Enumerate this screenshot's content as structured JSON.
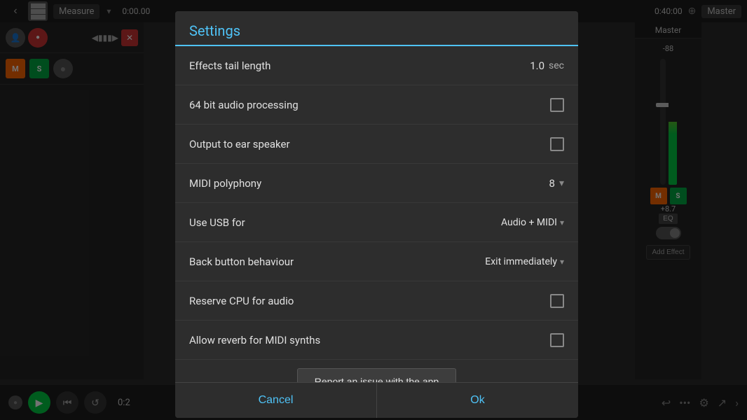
{
  "topbar": {
    "nav_back": "‹",
    "grid_icon": "grid",
    "measure_label": "Measure",
    "dropdown": "▾",
    "time_left": "0:00.00",
    "time_right": "0:40:00",
    "master_label": "Master",
    "knob_icon": "⊕"
  },
  "transport": {
    "record_label": "●",
    "play_label": "▶",
    "rewind_label": "⏮",
    "loop_label": "↺",
    "time_code": "0:2",
    "share_icon": "↗",
    "dots_icon": "•••",
    "gear_icon": "⚙",
    "arrow_icon": "›"
  },
  "master_panel": {
    "title": "Master",
    "volume_slider": "-88",
    "db_value": "+8.7",
    "m_label": "M",
    "s_label": "S",
    "eq_label": "EQ",
    "add_effect": "Add Effect"
  },
  "settings": {
    "title": "Settings",
    "items": [
      {
        "label": "Effects tail length",
        "value": "1.0",
        "unit": "sec",
        "type": "number"
      },
      {
        "label": "64 bit audio processing",
        "value": "",
        "type": "checkbox",
        "checked": false
      },
      {
        "label": "Output to ear speaker",
        "value": "",
        "type": "checkbox",
        "checked": false
      },
      {
        "label": "MIDI polyphony",
        "value": "8",
        "type": "spinner"
      },
      {
        "label": "Use USB for",
        "value": "Audio + MIDI",
        "type": "dropdown"
      },
      {
        "label": "Back button behaviour",
        "value": "Exit immediately",
        "type": "dropdown"
      },
      {
        "label": "Reserve CPU for audio",
        "value": "",
        "type": "checkbox",
        "checked": false
      },
      {
        "label": "Allow reverb for MIDI synths",
        "value": "",
        "type": "checkbox",
        "checked": false
      }
    ],
    "report_btn": "Report an issue with the app",
    "cancel_btn": "Cancel",
    "ok_btn": "Ok"
  }
}
